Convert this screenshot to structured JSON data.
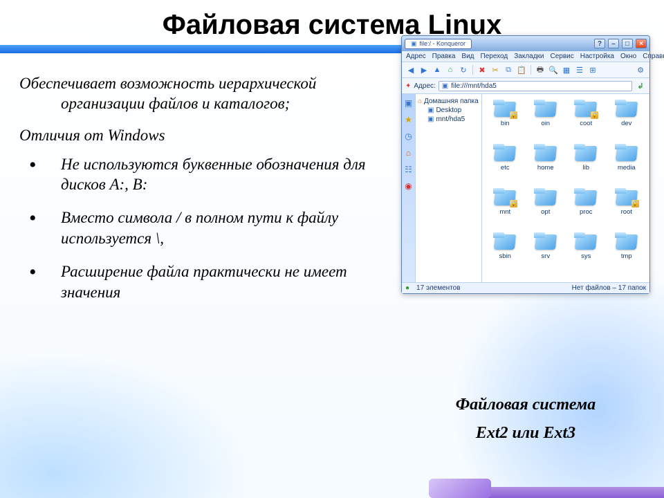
{
  "title": "Файловая система Linux",
  "intro_line1": "Обеспечивает возможность иерархической",
  "intro_line2": "организации файлов и каталогов;",
  "subhead": "Отличия от Windows",
  "bullets": [
    "Не используются буквенные обозначения для дисков A:, B:",
    "Вместо символа / в полном пути к файлу используется \\,",
    "Расширение файла практически не имеет значения"
  ],
  "caption_line1": "Файловая система",
  "caption_line2": "Ext2 или Ext3",
  "fm": {
    "window_title": "file:/ - Konqueror",
    "menubar": [
      "Адрес",
      "Правка",
      "Вид",
      "Переход",
      "Закладки",
      "Сервис",
      "Настройка",
      "Окно",
      "Справка"
    ],
    "address_label": "Адрес:",
    "address_value": "file:///mnt/hda5",
    "go_button": "↲",
    "tree": {
      "root": "Домашняя папка",
      "children": [
        "Desktop",
        "mnt/hda5"
      ]
    },
    "rail_icons": [
      "folder-icon",
      "star-icon",
      "clock-icon",
      "home-icon",
      "network-icon",
      "root-icon"
    ],
    "toolbar_icons": [
      "back-icon",
      "forward-icon",
      "up-icon",
      "home-icon",
      "reload-icon",
      "stop-icon",
      "cut-icon",
      "copy-icon",
      "paste-icon",
      "print-icon",
      "zoom-in-icon",
      "zoom-out-icon",
      "view-icons-icon",
      "view-list-icon",
      "view-tree-icon"
    ],
    "folders": [
      {
        "name": "bin",
        "locked": true
      },
      {
        "name": "oin",
        "locked": false
      },
      {
        "name": "coot",
        "locked": true
      },
      {
        "name": "dev",
        "locked": false
      },
      {
        "name": "etc",
        "locked": false
      },
      {
        "name": "home",
        "locked": false
      },
      {
        "name": "lib",
        "locked": false
      },
      {
        "name": "media",
        "locked": false
      },
      {
        "name": "mnt",
        "locked": true
      },
      {
        "name": "opt",
        "locked": false
      },
      {
        "name": "proc",
        "locked": false
      },
      {
        "name": "root",
        "locked": true
      },
      {
        "name": "sbin",
        "locked": false
      },
      {
        "name": "srv",
        "locked": false
      },
      {
        "name": "sys",
        "locked": false
      },
      {
        "name": "tmp",
        "locked": false
      }
    ],
    "status_left": "17 элементов",
    "status_right": "Нет файлов – 17 папок",
    "gear_icon": "gear-icon"
  },
  "colors": {
    "accent": "#4fa0ff",
    "folder": "#4fa4e8"
  }
}
